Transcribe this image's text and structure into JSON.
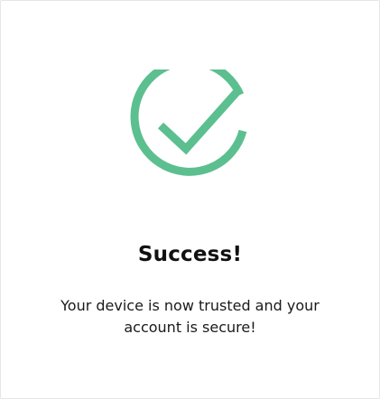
{
  "dialog": {
    "icon": "success-check-icon",
    "accent_color": "#5cbf8f",
    "title": "Success!",
    "message_line1": "Your device is now trusted and your",
    "message_line2": "account is secure!"
  }
}
